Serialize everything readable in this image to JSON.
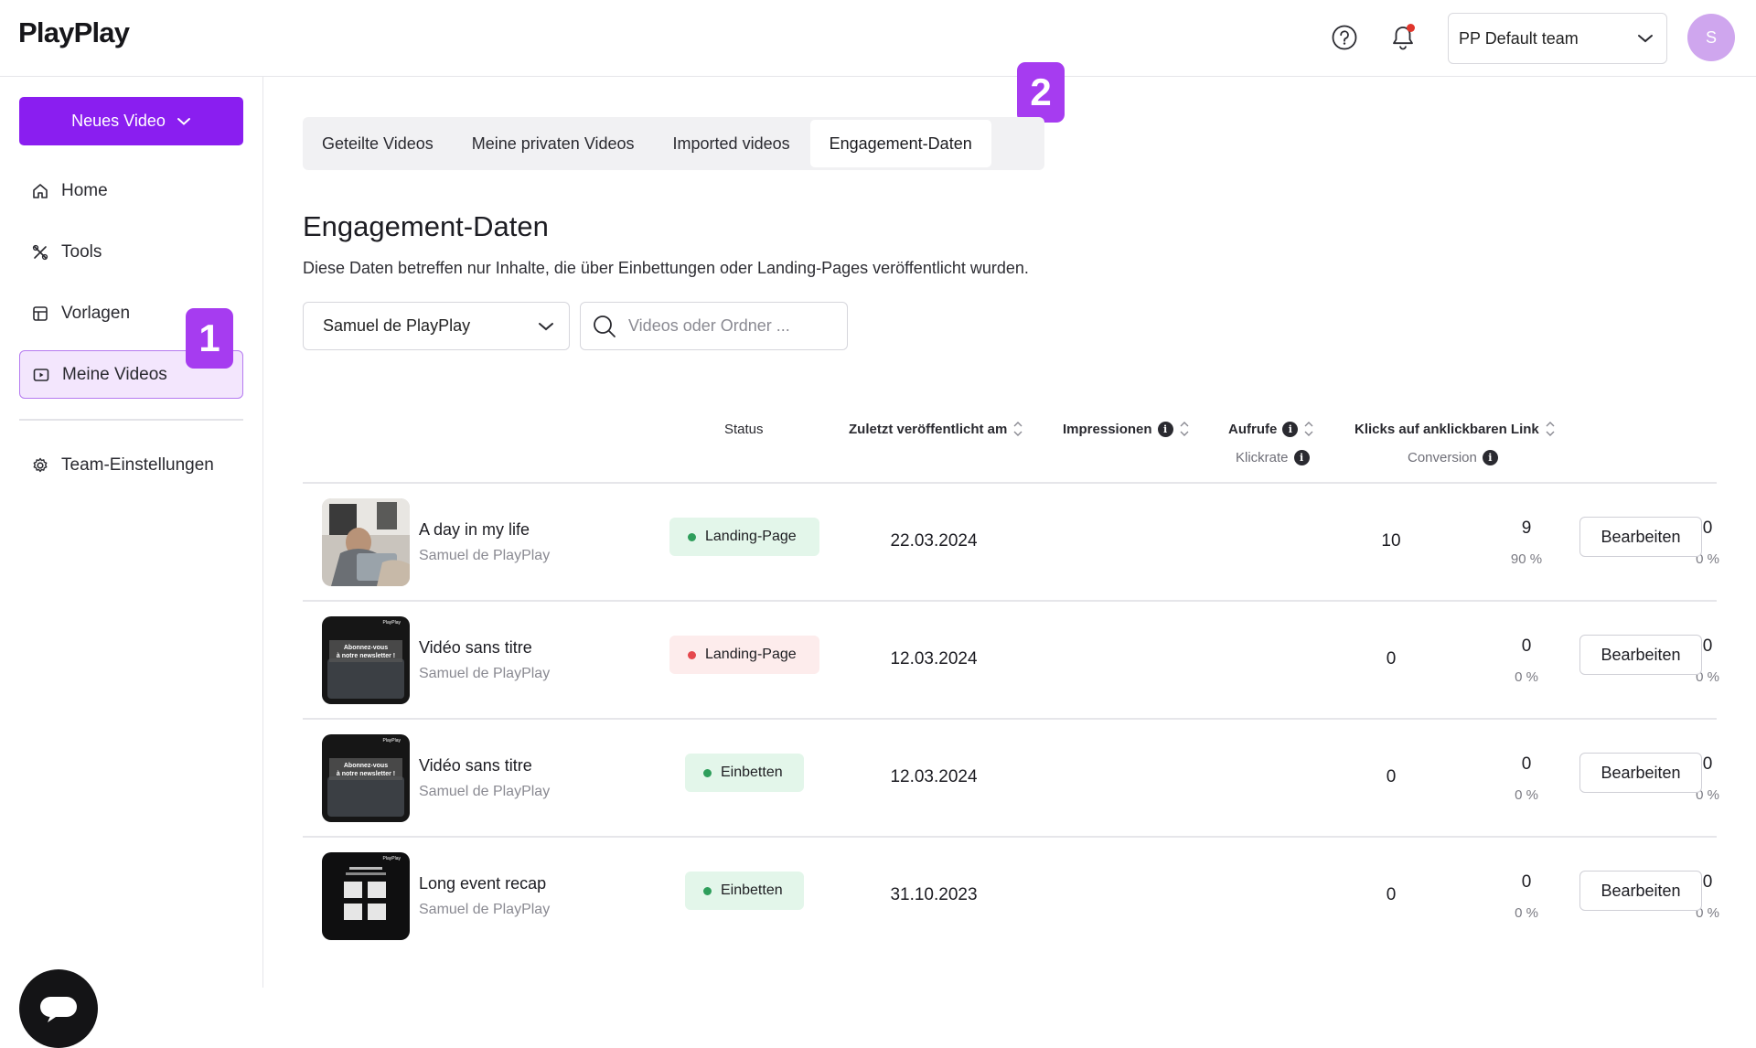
{
  "app": {
    "logo": "PlayPlay"
  },
  "topbar": {
    "team_select": "PP Default team",
    "avatar_initial": "S"
  },
  "sidebar": {
    "new_video_label": "Neues Video",
    "items": [
      {
        "label": "Home",
        "icon": "home-icon"
      },
      {
        "label": "Tools",
        "icon": "tools-icon"
      },
      {
        "label": "Vorlagen",
        "icon": "templates-icon"
      },
      {
        "label": "Meine Videos",
        "icon": "video-icon",
        "active": true
      },
      {
        "label": "Team-Einstellungen",
        "icon": "gear-icon"
      }
    ]
  },
  "annotations": {
    "step1": "1",
    "step2": "2"
  },
  "tabs": [
    {
      "label": "Geteilte Videos"
    },
    {
      "label": "Meine privaten Videos"
    },
    {
      "label": "Imported videos"
    },
    {
      "label": "Engagement-Daten",
      "active": true
    }
  ],
  "main": {
    "title": "Engagement-Daten",
    "subtitle": "Diese Daten betreffen nur Inhalte, die über Einbettungen oder Landing-Pages veröffentlicht wurden.",
    "owner_filter": "Samuel de PlayPlay",
    "search_placeholder": "Videos oder Ordner ..."
  },
  "table": {
    "headers": {
      "status": "Status",
      "published": "Zuletzt veröffentlicht am",
      "impressions": "Impressionen",
      "views": "Aufrufe",
      "views_sub": "Klickrate",
      "clicks": "Klicks auf anklickbaren Link",
      "clicks_sub": "Conversion"
    },
    "edit_label": "Bearbeiten",
    "rows": [
      {
        "title": "A day in my life",
        "owner": "Samuel de PlayPlay",
        "status": "Landing-Page",
        "status_color": "#2e9e5b",
        "date": "22.03.2024",
        "impressions": "10",
        "views": "9",
        "views_rate": "90 %",
        "clicks": "0",
        "conversion": "0 %"
      },
      {
        "title": "Vidéo sans titre",
        "owner": "Samuel de PlayPlay",
        "status": "Landing-Page",
        "status_color": "#e5484d",
        "date": "12.03.2024",
        "impressions": "0",
        "views": "0",
        "views_rate": "0 %",
        "clicks": "0",
        "conversion": "0 %"
      },
      {
        "title": "Vidéo sans titre",
        "owner": "Samuel de PlayPlay",
        "status": "Einbetten",
        "status_color": "#2e9e5b",
        "date": "12.03.2024",
        "impressions": "0",
        "views": "0",
        "views_rate": "0 %",
        "clicks": "0",
        "conversion": "0 %"
      },
      {
        "title": "Long event recap",
        "owner": "Samuel de PlayPlay",
        "status": "Einbetten",
        "status_color": "#2e9e5b",
        "date": "31.10.2023",
        "impressions": "0",
        "views": "0",
        "views_rate": "0 %",
        "clicks": "0",
        "conversion": "0 %"
      }
    ]
  },
  "colors": {
    "accent": "#8a1ef0",
    "annotation": "#a63cf0",
    "pill_green_bg": "#e3f6ea",
    "pill_red_bg": "#fdecec"
  }
}
